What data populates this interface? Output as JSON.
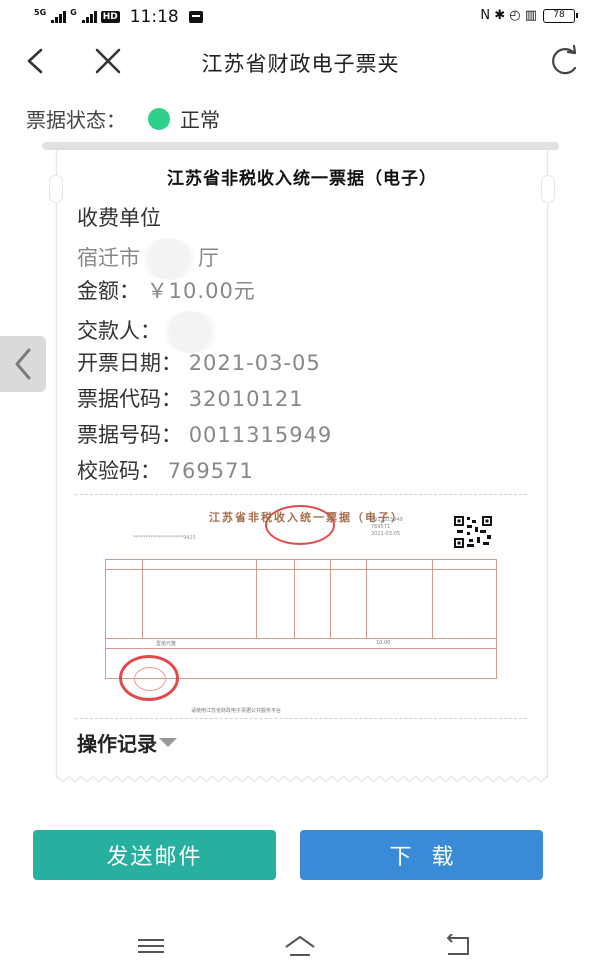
{
  "status_bar": {
    "network1": "5G",
    "network2": "G",
    "hd": "HD",
    "time": "11:18",
    "right_icons": "N ✱ ◴ ▥",
    "battery": "78"
  },
  "nav": {
    "title": "江苏省财政电子票夹",
    "back_icon": "chevron-left-icon",
    "close_icon": "close-icon",
    "refresh_icon": "refresh-icon"
  },
  "status": {
    "label": "票据状态：",
    "value": "正常",
    "color": "#2fd08c"
  },
  "ticket": {
    "title": "江苏省非税收入统一票据（电子）",
    "unit_label": "收费单位",
    "unit_value_a": "宿迁市",
    "unit_value_b": "厅",
    "amount_label": "金额：",
    "amount_value": "￥10.00元",
    "payer_label": "交款人：",
    "date_label": "开票日期：",
    "date_value": "2021-03-05",
    "code_label": "票据代码：",
    "code_value": "32010121",
    "number_label": "票据号码：",
    "number_value": "0011315949",
    "check_label": "校验码：",
    "check_value": "769571"
  },
  "invoice_image": {
    "title": "江苏省非税收入统一票据（电子）",
    "masked_code": "********************9425",
    "meta_right_1": "0011315949",
    "meta_right_2": "769571",
    "meta_right_3": "2021-03-05",
    "amount_small": "10.00",
    "capital_small": "壹拾元整",
    "footer_small": "请使用江苏省财政电子票据公共服务平台"
  },
  "ops": {
    "label": "操作记录"
  },
  "buttons": {
    "email": "发送邮件",
    "download": "下载"
  },
  "colors": {
    "email_button": "#27b0a0",
    "download_button": "#3a8bd6",
    "stamp_red": "#e24a4a"
  }
}
